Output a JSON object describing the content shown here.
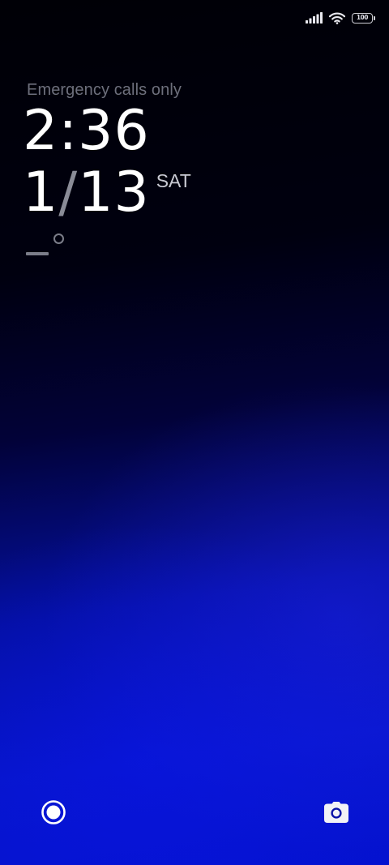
{
  "status_bar": {
    "icons": [
      "signal-icon",
      "wifi-icon",
      "battery-icon"
    ],
    "battery_level": "100"
  },
  "lockscreen": {
    "network_status": "Emergency calls only",
    "time": "2:36",
    "date_month": "1",
    "date_separator": "/",
    "date_day": "13",
    "weekday": "SAT",
    "weather_icon": "degree-icon"
  },
  "shortcuts": {
    "left_icon": "voice-assistant-icon",
    "right_icon": "camera-icon"
  },
  "colors": {
    "background_top": "#000008",
    "background_bottom": "#0616c8",
    "text_primary": "#ffffff",
    "text_muted": "#6d6f7c"
  }
}
